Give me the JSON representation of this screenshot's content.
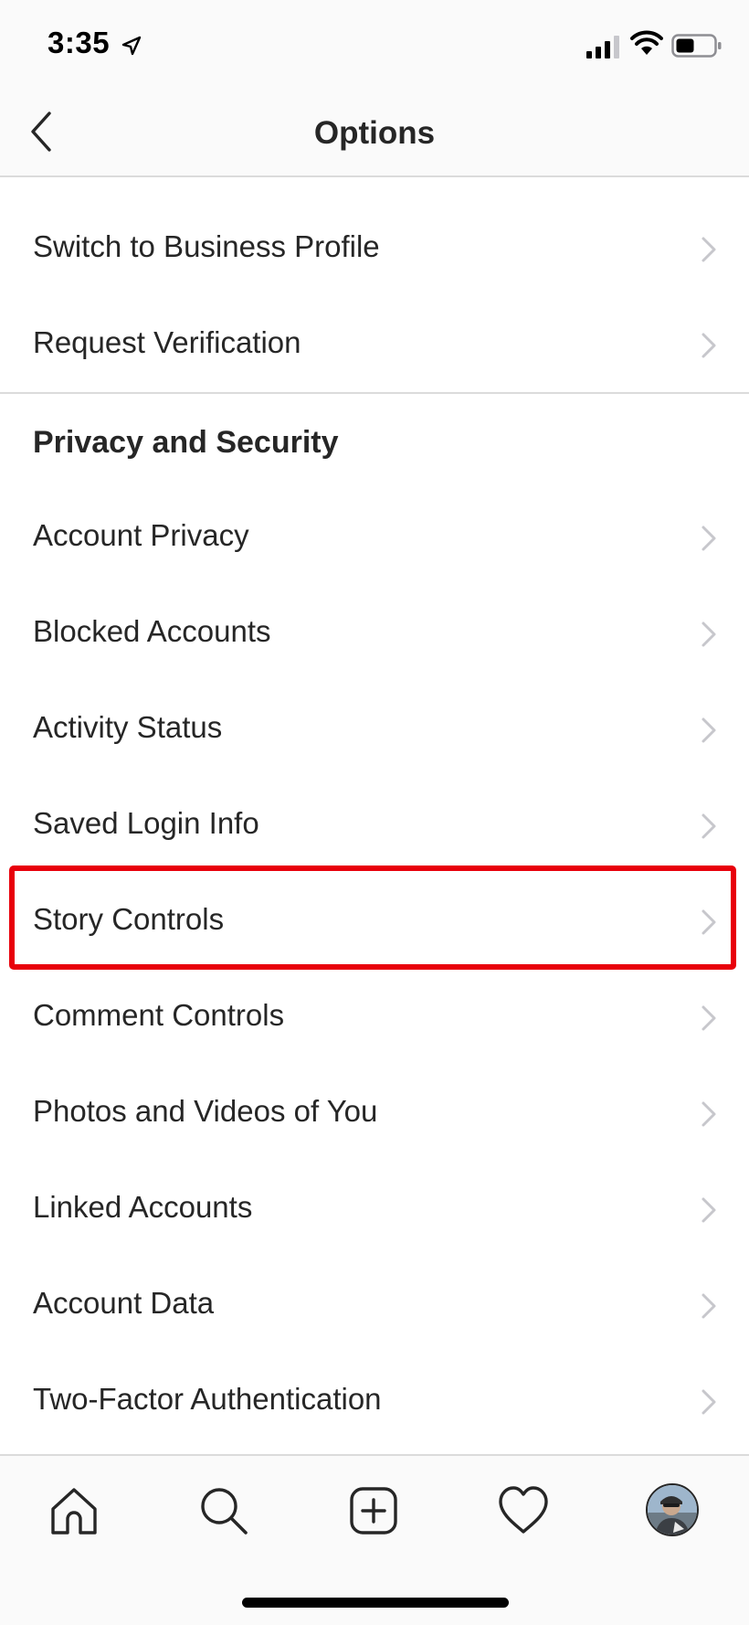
{
  "status_bar": {
    "time": "3:35"
  },
  "header": {
    "title": "Options"
  },
  "account_rows": [
    {
      "label": "Switch to Business Profile"
    },
    {
      "label": "Request Verification"
    }
  ],
  "privacy_section": {
    "title": "Privacy and Security",
    "items": [
      {
        "label": "Account Privacy"
      },
      {
        "label": "Blocked Accounts"
      },
      {
        "label": "Activity Status"
      },
      {
        "label": "Saved Login Info"
      },
      {
        "label": "Story Controls"
      },
      {
        "label": "Comment Controls"
      },
      {
        "label": "Photos and Videos of You"
      },
      {
        "label": "Linked Accounts"
      },
      {
        "label": "Account Data"
      },
      {
        "label": "Two-Factor Authentication"
      }
    ]
  },
  "highlight": {
    "target": "Story Controls",
    "color": "#e8000b"
  },
  "tab_bar": {
    "tabs": [
      {
        "icon": "home-icon"
      },
      {
        "icon": "search-icon"
      },
      {
        "icon": "new-post-icon"
      },
      {
        "icon": "activity-heart-icon"
      },
      {
        "icon": "profile-avatar"
      }
    ]
  },
  "colors": {
    "text": "#262626",
    "divider": "#dbdbdb",
    "bar_background": "#fafafa",
    "chevron": "#c7c7cc"
  }
}
